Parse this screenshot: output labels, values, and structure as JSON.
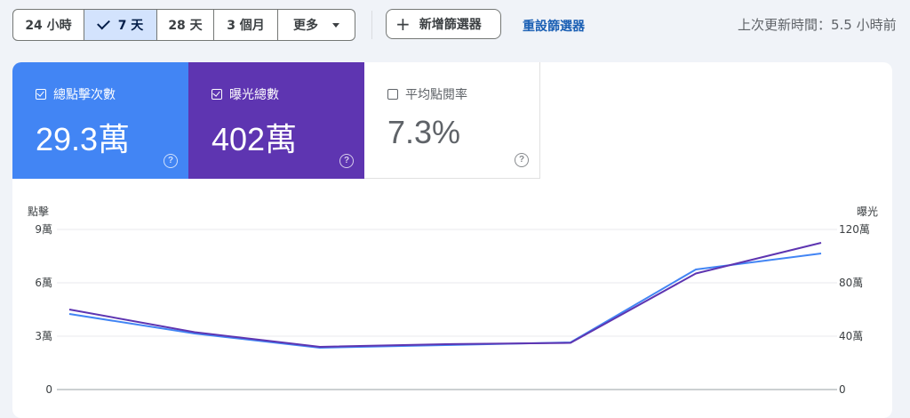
{
  "toolbar": {
    "ranges": [
      {
        "label": "24 小時",
        "active": false
      },
      {
        "label": "7 天",
        "active": true
      },
      {
        "label": "28 天",
        "active": false
      },
      {
        "label": "3 個月",
        "active": false
      },
      {
        "label": "更多",
        "active": false
      }
    ],
    "add_filter_label": "新增篩選器",
    "reset_label": "重設篩選器",
    "updated_text": "上次更新時間：5.5 小時前"
  },
  "metrics": [
    {
      "label": "總點擊次數",
      "value": "29.3萬",
      "checked": true,
      "color": "#4285f4"
    },
    {
      "label": "曝光總數",
      "value": "402萬",
      "checked": true,
      "color": "#5e35b1"
    },
    {
      "label": "平均點閱率",
      "value": "7.3%",
      "checked": false,
      "color": "#ffffff"
    }
  ],
  "chart_data": {
    "type": "line",
    "y_left_label": "點擊",
    "y_right_label": "曝光",
    "y_left_ticks": [
      "0",
      "3萬",
      "6萬",
      "9萬"
    ],
    "y_right_ticks": [
      "0",
      "40萬",
      "80萬",
      "120萬"
    ],
    "y_left_range": [
      0,
      90000
    ],
    "y_right_range": [
      0,
      1200000
    ],
    "series": [
      {
        "axis": "left",
        "color": "#4285f4",
        "values": [
          42500,
          31500,
          23500,
          25000,
          26500,
          67500,
          76500
        ]
      },
      {
        "axis": "right",
        "color": "#5e35b1",
        "values": [
          600000,
          430000,
          320000,
          340000,
          350000,
          870000,
          1100000
        ]
      }
    ]
  }
}
